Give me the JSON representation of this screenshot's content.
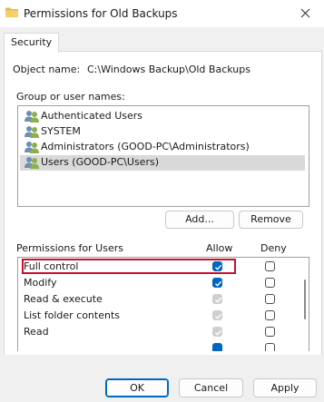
{
  "window": {
    "title": "Permissions for Old Backups"
  },
  "tabs": [
    {
      "label": "Security"
    }
  ],
  "object": {
    "label": "Object name:",
    "value": "C:\\Windows Backup\\Old Backups"
  },
  "group": {
    "label": "Group or user names:",
    "items": [
      {
        "label": "Authenticated Users",
        "selected": false
      },
      {
        "label": "SYSTEM",
        "selected": false
      },
      {
        "label": "Administrators (GOOD-PC\\Administrators)",
        "selected": false
      },
      {
        "label": "Users (GOOD-PC\\Users)",
        "selected": true
      }
    ]
  },
  "buttons": {
    "add": "Add...",
    "remove": "Remove",
    "ok": "OK",
    "cancel": "Cancel",
    "apply": "Apply"
  },
  "permissions": {
    "label": "Permissions for Users",
    "allow_header": "Allow",
    "deny_header": "Deny",
    "rows": [
      {
        "name": "Full control",
        "allow": "checked",
        "deny": "empty"
      },
      {
        "name": "Modify",
        "allow": "checked",
        "deny": "empty"
      },
      {
        "name": "Read & execute",
        "allow": "disabled",
        "deny": "empty"
      },
      {
        "name": "List folder contents",
        "allow": "disabled",
        "deny": "empty"
      },
      {
        "name": "Read",
        "allow": "disabled",
        "deny": "empty"
      },
      {
        "name": "",
        "allow": "checked",
        "deny": "empty"
      }
    ]
  },
  "colors": {
    "accent": "#0067c0",
    "highlight": "#c8102e",
    "selection": "#d9d9d9"
  }
}
